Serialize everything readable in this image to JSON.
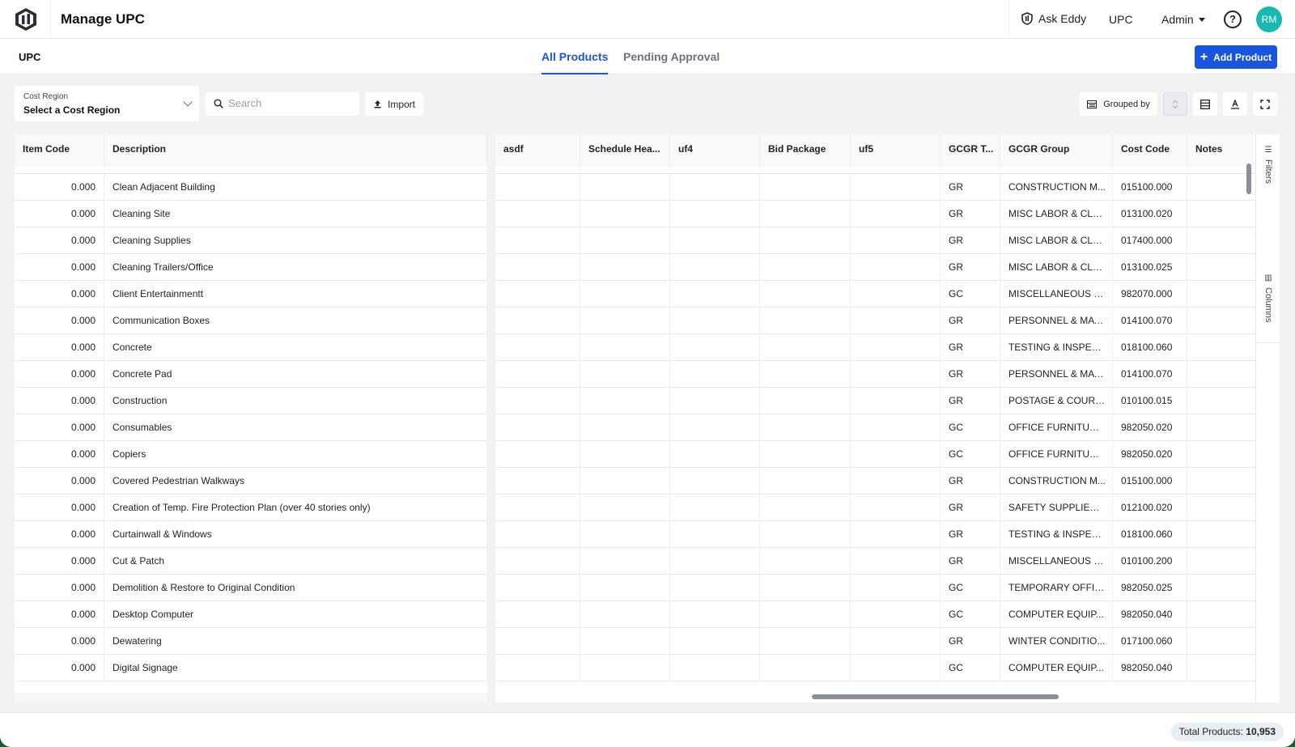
{
  "app": {
    "title": "Manage UPC"
  },
  "topnav": {
    "ask_eddy": "Ask Eddy",
    "upc": "UPC",
    "admin": "Admin",
    "help": "?",
    "avatar_initials": "RM"
  },
  "subheader": {
    "title": "UPC",
    "tabs": [
      {
        "label": "All Products",
        "active": true
      },
      {
        "label": "Pending Approval",
        "active": false
      }
    ],
    "add_button": "Add Product"
  },
  "toolbar": {
    "cost_region_label": "Cost Region",
    "cost_region_value": "Select a Cost Region",
    "search_placeholder": "Search",
    "import_label": "Import",
    "grouped_by_label": "Grouped by"
  },
  "grid": {
    "columns": [
      "Item Code",
      "Description",
      "asdf",
      "Schedule Hea...",
      "uf4",
      "Bid Package",
      "uf5",
      "GCGR T...",
      "GCGR Group",
      "Cost Code",
      "Notes"
    ],
    "rows": [
      {
        "item_code": "0.000",
        "description": "Clean Adjacent Building",
        "gcgr_type": "GR",
        "gcgr_group": "CONSTRUCTION M...",
        "cost_code": "015100.000"
      },
      {
        "item_code": "0.000",
        "description": "Cleaning Site",
        "gcgr_type": "GR",
        "gcgr_group": "MISC LABOR & CLE...",
        "cost_code": "013100.020"
      },
      {
        "item_code": "0.000",
        "description": "Cleaning Supplies",
        "gcgr_type": "GR",
        "gcgr_group": "MISC LABOR & CLE...",
        "cost_code": "017400.000"
      },
      {
        "item_code": "0.000",
        "description": "Cleaning Trailers/Office",
        "gcgr_type": "GR",
        "gcgr_group": "MISC LABOR & CLE...",
        "cost_code": "013100.025"
      },
      {
        "item_code": "0.000",
        "description": "Client Entertainmentt",
        "gcgr_type": "GC",
        "gcgr_group": "MISCELLANEOUS E...",
        "cost_code": "982070.000"
      },
      {
        "item_code": "0.000",
        "description": "Communication Boxes",
        "gcgr_type": "GR",
        "gcgr_group": "PERSONNEL & MAT...",
        "cost_code": "014100.070"
      },
      {
        "item_code": "0.000",
        "description": "Concrete",
        "gcgr_type": "GR",
        "gcgr_group": "TESTING & INSPECT...",
        "cost_code": "018100.060"
      },
      {
        "item_code": "0.000",
        "description": "Concrete Pad",
        "gcgr_type": "GR",
        "gcgr_group": "PERSONNEL & MAT...",
        "cost_code": "014100.070"
      },
      {
        "item_code": "0.000",
        "description": "Construction",
        "gcgr_type": "GR",
        "gcgr_group": "POSTAGE & COURIER",
        "cost_code": "010100.015"
      },
      {
        "item_code": "0.000",
        "description": "Consumables",
        "gcgr_type": "GC",
        "gcgr_group": "OFFICE FURNITURE ...",
        "cost_code": "982050.020"
      },
      {
        "item_code": "0.000",
        "description": "Copiers",
        "gcgr_type": "GC",
        "gcgr_group": "OFFICE FURNITURE ...",
        "cost_code": "982050.020"
      },
      {
        "item_code": "0.000",
        "description": "Covered Pedestrian Walkways",
        "gcgr_type": "GR",
        "gcgr_group": "CONSTRUCTION M...",
        "cost_code": "015100.000"
      },
      {
        "item_code": "0.000",
        "description": "Creation of Temp. Fire Protection Plan (over 40 stories only)",
        "gcgr_type": "GR",
        "gcgr_group": "SAFETY SUPPLIES ...",
        "cost_code": "012100.020"
      },
      {
        "item_code": "0.000",
        "description": "Curtainwall & Windows",
        "gcgr_type": "GR",
        "gcgr_group": "TESTING & INSPECT...",
        "cost_code": "018100.060"
      },
      {
        "item_code": "0.000",
        "description": "Cut & Patch",
        "gcgr_type": "GR",
        "gcgr_group": "MISCELLANEOUS S...",
        "cost_code": "010100.200"
      },
      {
        "item_code": "0.000",
        "description": "Demolition & Restore to Original Condition",
        "gcgr_type": "GC",
        "gcgr_group": "TEMPORARY OFFIC...",
        "cost_code": "982050.025"
      },
      {
        "item_code": "0.000",
        "description": "Desktop Computer",
        "gcgr_type": "GC",
        "gcgr_group": "COMPUTER EQUIP...",
        "cost_code": "982050.040"
      },
      {
        "item_code": "0.000",
        "description": "Dewatering",
        "gcgr_type": "GR",
        "gcgr_group": "WINTER CONDITIO...",
        "cost_code": "017100.060"
      },
      {
        "item_code": "0.000",
        "description": "Digital Signage",
        "gcgr_type": "GC",
        "gcgr_group": "COMPUTER EQUIP...",
        "cost_code": "982050.040"
      }
    ]
  },
  "side_panel": {
    "filters": "Filters",
    "columns": "Columns"
  },
  "footer": {
    "total_label": "Total Products:",
    "total_value": "10,953"
  },
  "colors": {
    "accent": "#1a56db",
    "avatar": "#19b8b3"
  }
}
